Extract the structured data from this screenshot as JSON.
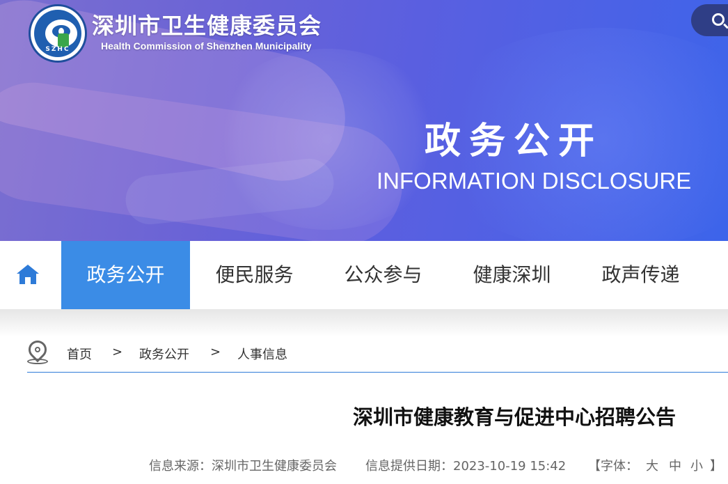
{
  "header": {
    "site_title": "深圳市卫生健康委员会",
    "site_subtitle": "Health Commission of Shenzhen Municipality",
    "logo_text": "SZHC"
  },
  "banner": {
    "title": "政务公开",
    "subtitle": "INFORMATION DISCLOSURE"
  },
  "nav": {
    "items": [
      {
        "label": "政务公开",
        "active": true
      },
      {
        "label": "便民服务",
        "active": false
      },
      {
        "label": "公众参与",
        "active": false
      },
      {
        "label": "健康深圳",
        "active": false
      },
      {
        "label": "政声传递",
        "active": false
      }
    ]
  },
  "breadcrumb": {
    "items": [
      "首页",
      "政务公开",
      "人事信息"
    ],
    "separator": ">"
  },
  "article": {
    "title": "深圳市健康教育与促进中心招聘公告",
    "source_label": "信息来源：深圳市卫生健康委员会",
    "date_label": "信息提供日期：2023-10-19 15:42",
    "font_label": "【字体：",
    "font_large": "大",
    "font_medium": "中",
    "font_small": "小",
    "font_close": "】"
  },
  "colors": {
    "accent": "#3b8ce6",
    "banner": "#5a5fe0"
  }
}
